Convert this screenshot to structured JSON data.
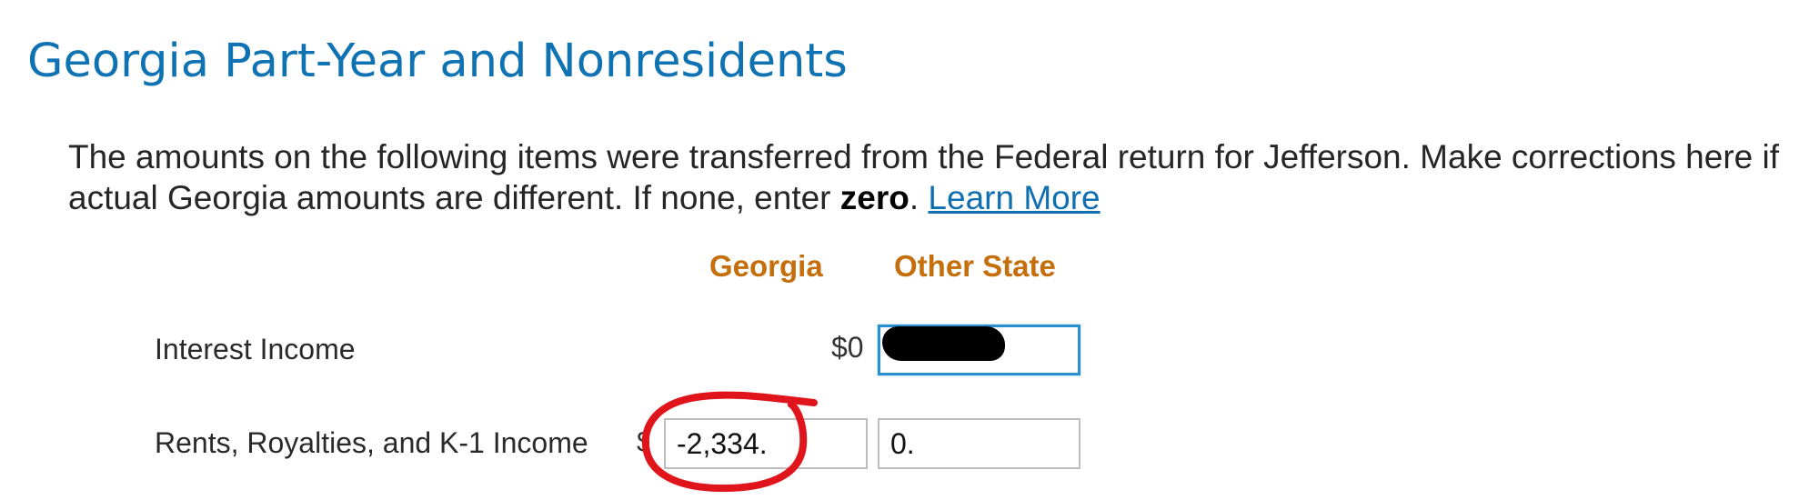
{
  "header": {
    "title": "Georgia Part-Year and Nonresidents"
  },
  "intro": {
    "text_before": "The amounts on the following items were transferred from the Federal return for Jefferson. Make corrections here if actual Georgia amounts are different. If none, enter ",
    "emphasis": "zero",
    "text_after": ". ",
    "link_label": "Learn More"
  },
  "columns": {
    "georgia": "Georgia",
    "other_state": "Other State"
  },
  "rows": [
    {
      "label": "Interest Income",
      "georgia_value": "$0",
      "other_state_value": ""
    },
    {
      "label": "Rents, Royalties, and K-1 Income",
      "currency_symbol": "$",
      "georgia_value": "-2,334.",
      "other_state_value": "0."
    }
  ],
  "colors": {
    "title": "#0f72b3",
    "column_header": "#c46f0c",
    "link": "#0f6fb0",
    "annotation": "#e0141b"
  }
}
